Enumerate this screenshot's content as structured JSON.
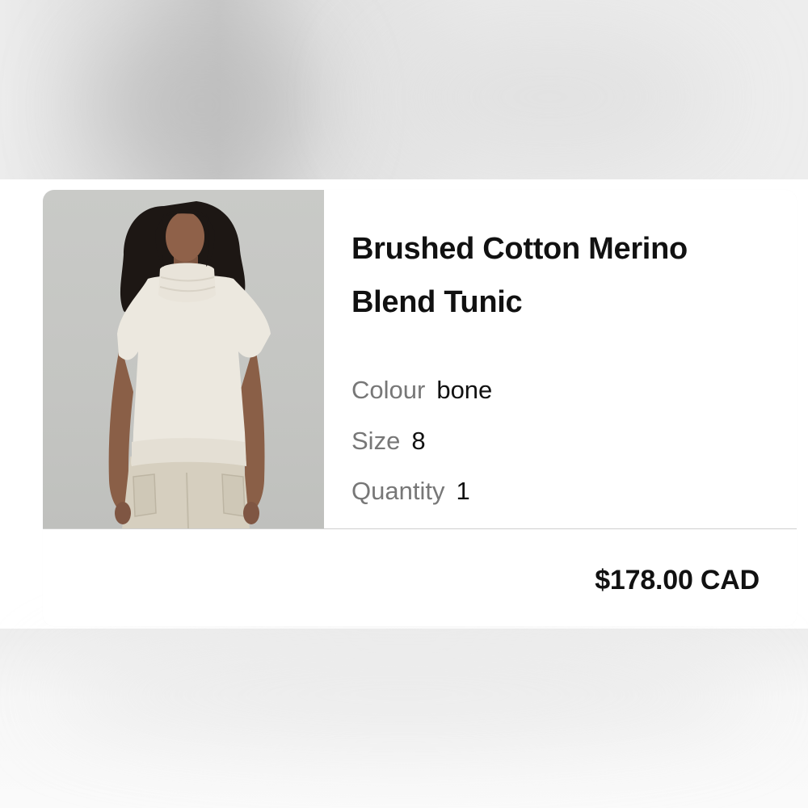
{
  "cart_item": {
    "image_alt": "Model wearing Brushed Cotton Merino Blend Tunic in bone",
    "title": "Brushed Cotton Merino Blend Tunic",
    "colour_label": "Colour",
    "colour_value": "bone",
    "size_label": "Size",
    "size_value": "8",
    "quantity_label": "Quantity",
    "quantity_value": "1"
  },
  "price": "$178.00 CAD",
  "colors": {
    "text": "#111111",
    "muted_label": "#777777",
    "image_background": "#c6c7c4",
    "garment": "#ece8df"
  }
}
